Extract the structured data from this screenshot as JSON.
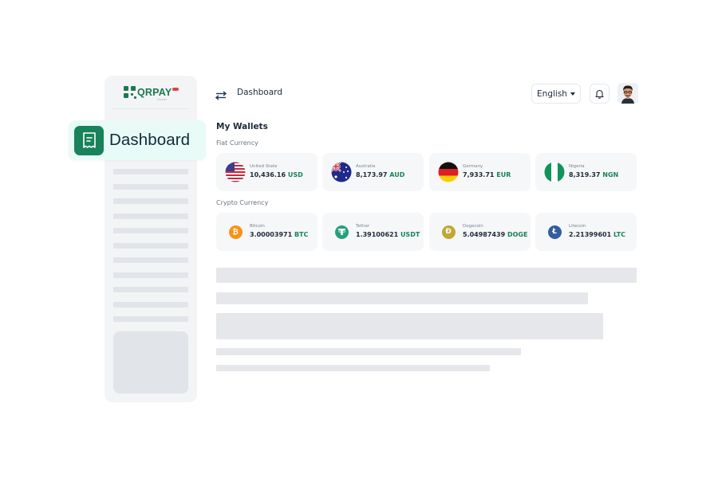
{
  "app": {
    "logo_text": "QRPAY",
    "logo_sub": "AGENT"
  },
  "sidebar": {
    "active_item": {
      "label": "Dashboard",
      "icon": "receipt-icon"
    }
  },
  "header": {
    "title": "Dashboard",
    "language": "English",
    "toggle_icon": "swap-arrows-icon",
    "bell_icon": "bell-icon"
  },
  "wallets": {
    "title": "My Wallets",
    "fiat_label": "Fiat Currency",
    "crypto_label": "Crypto Currency",
    "fiat": [
      {
        "name": "United State",
        "amount": "10,436.16",
        "currency": "USD",
        "flag": "us-flag-icon"
      },
      {
        "name": "Australia",
        "amount": "8,173.97",
        "currency": "AUD",
        "flag": "au-flag-icon"
      },
      {
        "name": "Germany",
        "amount": "7,933.71",
        "currency": "EUR",
        "flag": "de-flag-icon"
      },
      {
        "name": "Nigeria",
        "amount": "8,319.37",
        "currency": "NGN",
        "flag": "ng-flag-icon"
      }
    ],
    "crypto": [
      {
        "name": "Bitcoin",
        "amount": "3.00003971",
        "currency": "BTC",
        "icon": "bitcoin-icon",
        "color": "#f7931a"
      },
      {
        "name": "Tether",
        "amount": "1.39100621",
        "currency": "USDT",
        "icon": "tether-icon",
        "color": "#26a17b"
      },
      {
        "name": "Dogecoin",
        "amount": "5.04987439",
        "currency": "DOGE",
        "icon": "dogecoin-icon",
        "color": "#c3a634"
      },
      {
        "name": "Litecoin",
        "amount": "2.21399601",
        "currency": "LTC",
        "icon": "litecoin-icon",
        "color": "#345d9d"
      }
    ]
  },
  "colors": {
    "brand": "#18825a",
    "chip_bg": "#e8fbf6"
  }
}
